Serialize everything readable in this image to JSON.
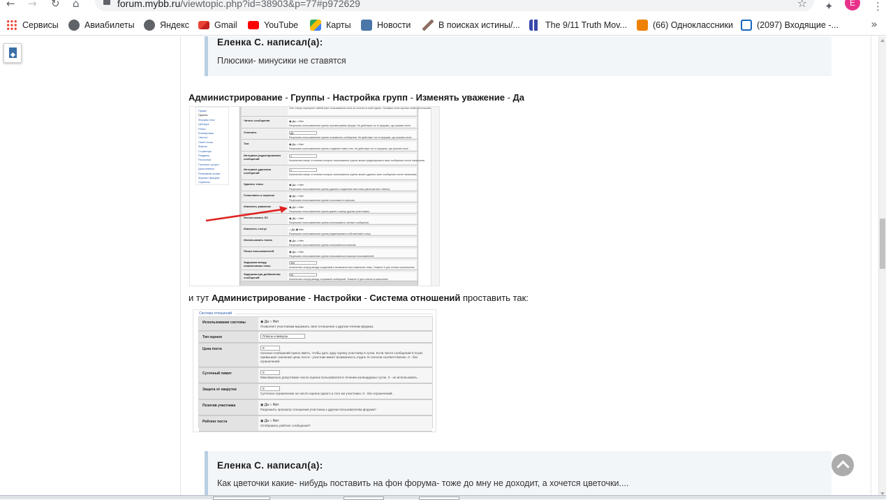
{
  "browser": {
    "url_host": "forum.mybb.ru",
    "url_path": "/viewtopic.php?id=38903&p=77#p972629",
    "back_glyph": "←",
    "forward_glyph": "→",
    "reload_glyph": "↻",
    "home_glyph": "⌂",
    "star_glyph": "☆",
    "profile_letter": "E",
    "menu_glyph": "⋮",
    "ext_glyph": "✦",
    "more_glyph": "»",
    "bookmarks": [
      {
        "label": "Сервисы",
        "icon": "apps-grid-icon",
        "color": "#4285f4"
      },
      {
        "label": "Авиабилеты",
        "icon": "globe-icon",
        "color": "#5f6368"
      },
      {
        "label": "Яндекс",
        "icon": "globe-icon",
        "color": "#5f6368"
      },
      {
        "label": "Gmail",
        "icon": "gmail-icon",
        "color": "#ea4335"
      },
      {
        "label": "YouTube",
        "icon": "youtube-icon",
        "color": "#ff0000"
      },
      {
        "label": "Карты",
        "icon": "maps-icon",
        "color": "#34a853"
      },
      {
        "label": "Новости",
        "icon": "vk-icon",
        "color": "#4a76a8"
      },
      {
        "label": "В поисках истины/...",
        "icon": "pen-icon",
        "color": "#8d6e63"
      },
      {
        "label": "The 9/11 Truth Mov...",
        "icon": "tower-icon",
        "color": "#3949ab"
      },
      {
        "label": "(66) Одноклассники",
        "icon": "ok-icon",
        "color": "#ee8208"
      },
      {
        "label": "(2097) Входящие -...",
        "icon": "mail-icon",
        "color": "#1565c0"
      }
    ]
  },
  "post": {
    "quote1": {
      "author": "Еленка С. написал(а):",
      "text": "Плюсики- минусики не ставятся"
    },
    "path1": {
      "p1": "Администрирование",
      "sep1": " - ",
      "p2": "Группы",
      "sep2": "  - ",
      "p3": "Настройка групп",
      "sep3": " - ",
      "p4": "Изменять уважение",
      "sep4": " - ",
      "p5": "Да"
    },
    "path2": {
      "lead": "и тут ",
      "p1": "Администрирование",
      "sep1": " - ",
      "p2": "Настройки",
      "sep2": " - ",
      "p3": "Система отношений",
      "tail": " проставить так:"
    },
    "quote2": {
      "author": "Еленка С. написал(а):",
      "text": "Как цветочки какие- нибудь поставить на фон форума- тоже до мну не доходит, а хочется цветочки...."
    }
  },
  "screenshot1": {
    "menu": [
      "Права",
      "Группы",
      "Форумы new",
      "Цензура",
      "Ранги",
      "Блокировка",
      "Чистка",
      "Свой стиль",
      "Файлы",
      "Страницы",
      "Разделы",
      "Рассылки",
      "Платные услуги",
      "Дополнения",
      "Резервная копия",
      "Журнал форума",
      "Сервисы"
    ],
    "rows": [
      {
        "label": "",
        "opt": "",
        "desc": "Этот статус перекроет любой ранг пользователя если он состоит в этой группе. Оставьте поле пустым чтобы использовать ранг."
      },
      {
        "label": "Читать сообщения",
        "opt": "◉ Да   ○ Нет",
        "desc": "Разрешить пользователям группы просматривать форум. Не действует на те форумы, где указано иное."
      },
      {
        "label": "Отвечать",
        "opt": "Да",
        "desc": "Разрешить пользователям группы отправлять сообщения. Не действует на те форумы, где указано иное."
      },
      {
        "label": "Тем",
        "opt": "◉ Да   ○ Нет",
        "desc": "Разрешить пользователям группы создание новых тем. Не действует на те форумы, где указано иное."
      },
      {
        "label": "Интервал редактирования сообщений",
        "opt": "1",
        "desc": "Количество минут, в течение которых пользователь группы может редактировать свое сообщение после написания."
      },
      {
        "label": "Интервал удаления сообщений",
        "opt": "1",
        "desc": "Количество минут, в течение которых пользователь группы может удалить свое сообщение после написания."
      },
      {
        "label": "Удалять темы",
        "opt": "◉ Да   ○ Нет",
        "desc": "Разрешить пользователям группы удалять созданные ими темы (включая все ответы)."
      },
      {
        "label": "Голосовать в опросах",
        "opt": "◉ Да   ○ Нет",
        "desc": "Разрешить пользователям группы голосовать в опросах."
      },
      {
        "label": "Изменять уважение",
        "opt": "◉ Да   ○ Нет",
        "desc": "Разрешить пользователям группы давать оценку другим участникам."
      },
      {
        "label": "Использовать ЛС",
        "opt": "◉ Да   ○ Нет",
        "desc": "Разрешить пользователям группы использовать личные сообщения."
      },
      {
        "label": "Изменять статус",
        "opt": "○ Да   ◉ Нет",
        "desc": "Разрешить пользователям группы редактировать собственный статус."
      },
      {
        "label": "Использовать поиск",
        "opt": "◉ Да   ○ Нет",
        "desc": "Разрешить пользователям группы пользоваться поиском."
      },
      {
        "label": "Поиск пользователей",
        "opt": "◉ Да   ○ Нет",
        "desc": "Разрешить пользователям группы пользоваться поиском пользователей."
      },
      {
        "label": "Задержка между появлениями темы",
        "opt": "300",
        "desc": "Количество секунд между созданием и возможностью появления темы. Укажите 0 для снятия ограничения."
      },
      {
        "label": "Задержка при добавлении сообщений",
        "opt": "60",
        "desc": "Количество секунд между отправкой сообщений. Укажите 0 для снятия ограничения."
      }
    ]
  },
  "screenshot2": {
    "title": "Система отношений",
    "rows": [
      {
        "label": "Использование системы",
        "opt": "◉ Да   ○ Нет",
        "desc": "Позволяет участникам выражать свое отношение к другим членам форума."
      },
      {
        "label": "Тип оценок",
        "sel": "Плюсы и минусы",
        "desc": ""
      },
      {
        "label": "Цена поста",
        "inp": "0",
        "desc": "Сколько сообщений нужно иметь, чтобы дать одну оценку участнику в сутки. Если число сообщений в N раз превышает значение цены поста - участник имеет возможность отдать N голосов соответственно. 0 - без ограничений."
      },
      {
        "label": "Суточный лимит",
        "inp": "0",
        "desc": "Максимально допустимое число оценок пользователя в течение календарных суток. 0 - не использовать."
      },
      {
        "label": "Защита от накрутки",
        "inp": "0",
        "desc": "Суточное ограничение на число оценок одного и того же участника. 0 - без ограничений."
      },
      {
        "label": "Позитив участника",
        "opt": "◉ Да   ○ Нет",
        "desc": "Разрешить просмотр отношения участника к другим пользователям форума?"
      },
      {
        "label": "Рейтинг поста",
        "opt": "◉ Да   ○ Нет",
        "desc": "Отображать рейтинг сообщения?"
      }
    ]
  }
}
